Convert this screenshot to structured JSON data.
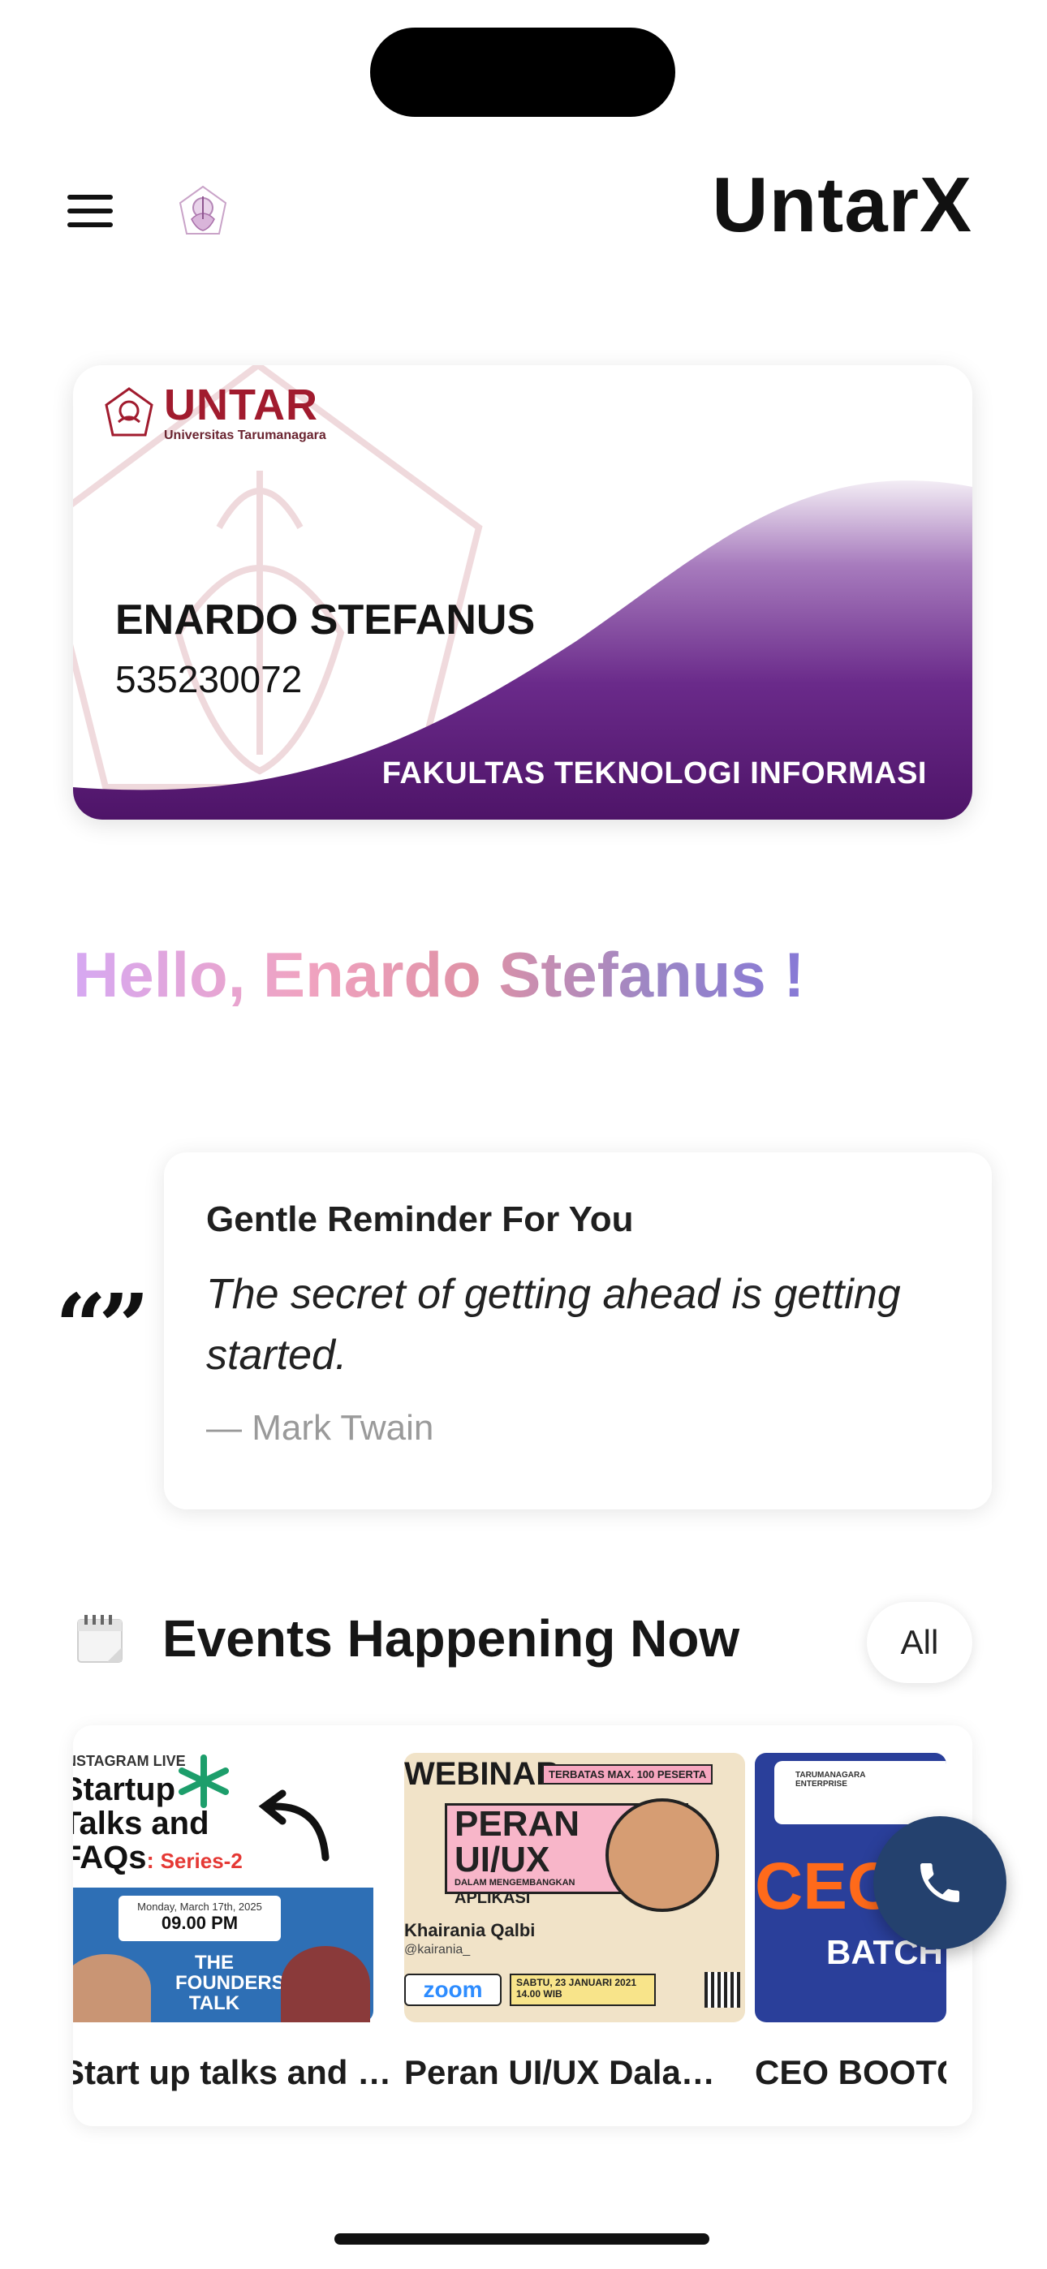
{
  "header": {
    "app_title": "UntarX",
    "menu_icon": "hamburger-icon",
    "logo": "untar-seal-icon"
  },
  "id_card": {
    "brand": "UNTAR",
    "brand_sub": "Universitas Tarumanagara",
    "student_name": "ENARDO STEFANUS",
    "student_id": "535230072",
    "faculty": "FAKULTAS TEKNOLOGI INFORMASI",
    "accent_color": "#5a1a78"
  },
  "greeting": {
    "text": "Hello, Enardo Stefanus !"
  },
  "quote": {
    "mark": "“”",
    "heading": "Gentle Reminder For You",
    "text": "The secret of getting ahead is getting started.",
    "author": "— Mark Twain"
  },
  "events": {
    "icon": "calendar-icon",
    "title": "Events Happening Now",
    "all_label": "All",
    "items": [
      {
        "label": "Start up talks and FAQs",
        "poster": {
          "tag": "INSTAGRAM LIVE",
          "headline_1": "Startup",
          "headline_2": "Talks and",
          "headline_3": "FAQs",
          "series": "Series-2",
          "date": "Monday, March 17th, 2025",
          "time": "09.00 PM",
          "show": "THE FOUNDERS TALK"
        }
      },
      {
        "label": "Peran UI/UX Dalam Mengembangkan Aplikasi",
        "poster": {
          "tag": "WEBINAR",
          "limit": "TERBATAS MAX. 100 PESERTA",
          "headline": "PERAN UI/UX",
          "sub": "DALAM MENGEMBANGKAN",
          "sub2": "APLIKASI",
          "speaker": "Khairania Qalbi",
          "handle": "@kairania_",
          "platform": "zoom",
          "date": "SABTU, 23 JANUARI 2021",
          "time": "14.00 WIB"
        }
      },
      {
        "label": "CEO BOOTCAMP",
        "poster": {
          "brand": "TARUMANAGARA ENTERPRISE",
          "headline": "CEO B",
          "sub": "BATCH"
        }
      }
    ]
  },
  "fab": {
    "icon": "phone-icon",
    "color": "#24416e"
  }
}
